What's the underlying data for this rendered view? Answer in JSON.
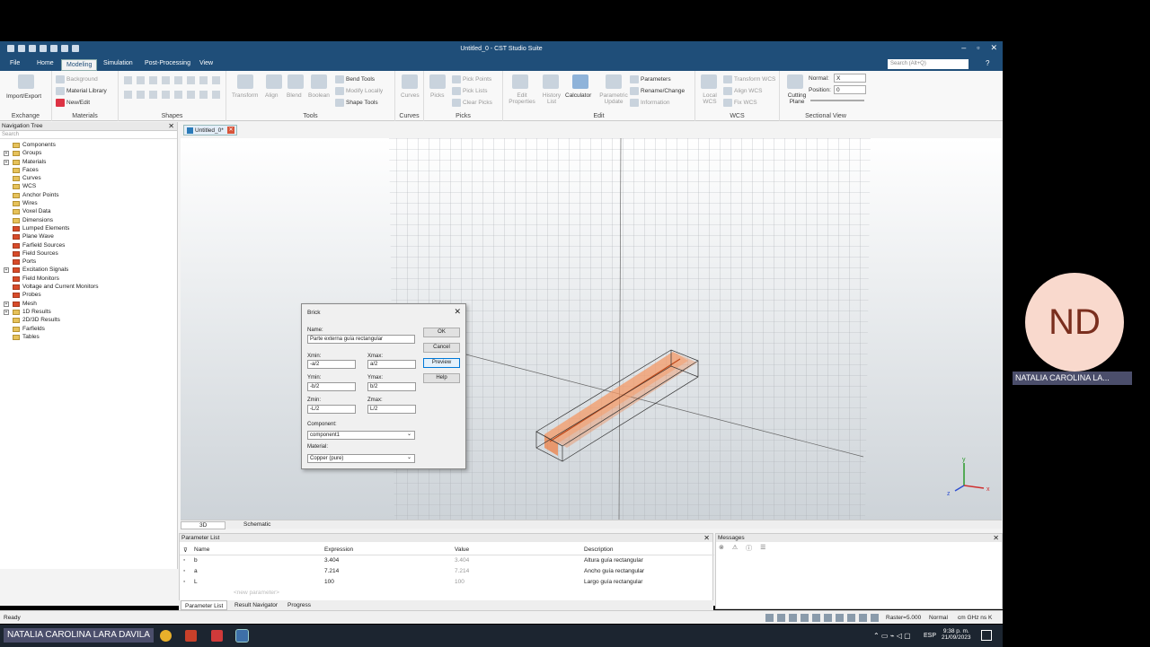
{
  "window": {
    "title": "Untitled_0 - CST Studio Suite",
    "min": "–",
    "max": "▫",
    "close": "✕"
  },
  "menu": {
    "tabs": [
      "File",
      "Home",
      "Modeling",
      "Simulation",
      "Post-Processing",
      "View"
    ],
    "active": "Modeling",
    "search_placeholder": "Search (Alt+Q)"
  },
  "ribbon": {
    "exchange": {
      "label": "Exchange",
      "import_export": "Import/Export"
    },
    "materials": {
      "label": "Materials",
      "background": "Background",
      "material_library": "Material Library",
      "new_edit": "New/Edit"
    },
    "shapes": {
      "label": "Shapes"
    },
    "tools": {
      "label": "Tools",
      "transform": "Transform",
      "align": "Align",
      "blend": "Blend",
      "boolean": "Boolean",
      "bend_tools": "Bend Tools",
      "modify_locally": "Modify Locally",
      "shape_tools": "Shape Tools"
    },
    "curves": {
      "label": "Curves",
      "curves": "Curves"
    },
    "picks": {
      "label": "Picks",
      "picks": "Picks",
      "pick_points": "Pick Points",
      "pick_lists": "Pick Lists",
      "clear_picks": "Clear Picks"
    },
    "edit": {
      "label": "Edit",
      "edit_properties": "Edit Properties",
      "history_list": "History List",
      "calculator": "Calculator",
      "parametric_update": "Parametric Update",
      "parameters": "Parameters",
      "rename_change": "Rename/Change",
      "information": "Information"
    },
    "wcs": {
      "label": "WCS",
      "local_wcs": "Local WCS",
      "transform_wcs": "Transform WCS",
      "align_wcs": "Align WCS",
      "fix_wcs": "Fix WCS"
    },
    "sectional": {
      "label": "Sectional View",
      "cutting_plane": "Cutting Plane",
      "normal_label": "Normal:",
      "normal_value": "X",
      "position_label": "Position:",
      "position_value": "0"
    }
  },
  "nav": {
    "title": "Navigation Tree",
    "search": "Search",
    "items": [
      {
        "label": "Components",
        "red": false,
        "exp": false
      },
      {
        "label": "Groups",
        "red": false,
        "exp": true
      },
      {
        "label": "Materials",
        "red": false,
        "exp": true
      },
      {
        "label": "Faces",
        "red": false,
        "exp": false
      },
      {
        "label": "Curves",
        "red": false,
        "exp": false
      },
      {
        "label": "WCS",
        "red": false,
        "exp": false
      },
      {
        "label": "Anchor Points",
        "red": false,
        "exp": false
      },
      {
        "label": "Wires",
        "red": false,
        "exp": false
      },
      {
        "label": "Voxel Data",
        "red": false,
        "exp": false
      },
      {
        "label": "Dimensions",
        "red": false,
        "exp": false
      },
      {
        "label": "Lumped Elements",
        "red": true,
        "exp": false
      },
      {
        "label": "Plane Wave",
        "red": true,
        "exp": false
      },
      {
        "label": "Farfield Sources",
        "red": true,
        "exp": false
      },
      {
        "label": "Field Sources",
        "red": true,
        "exp": false
      },
      {
        "label": "Ports",
        "red": true,
        "exp": false
      },
      {
        "label": "Excitation Signals",
        "red": true,
        "exp": true
      },
      {
        "label": "Field Monitors",
        "red": true,
        "exp": false
      },
      {
        "label": "Voltage and Current Monitors",
        "red": true,
        "exp": false
      },
      {
        "label": "Probes",
        "red": true,
        "exp": false
      },
      {
        "label": "Mesh",
        "red": true,
        "exp": true
      },
      {
        "label": "1D Results",
        "red": false,
        "exp": true
      },
      {
        "label": "2D/3D Results",
        "red": false,
        "exp": false
      },
      {
        "label": "Farfields",
        "red": false,
        "exp": false
      },
      {
        "label": "Tables",
        "red": false,
        "exp": false
      }
    ]
  },
  "document": {
    "tab": "Untitled_0*"
  },
  "viewtabs": [
    "3D",
    "Schematic"
  ],
  "axes": {
    "x": "x",
    "y": "y",
    "z": "z"
  },
  "dialog": {
    "title": "Brick",
    "name_label": "Name:",
    "name_value": "Parte externa guía rectangular",
    "xmin_label": "Xmin:",
    "xmin": "-a/2",
    "xmax_label": "Xmax:",
    "xmax": "a/2",
    "ymin_label": "Ymin:",
    "ymin": "-b/2",
    "ymax_label": "Ymax:",
    "ymax": "b/2",
    "zmin_label": "Zmin:",
    "zmin": "-L/2",
    "zmax_label": "Zmax:",
    "zmax": "L/2",
    "component_label": "Component:",
    "component": "component1",
    "material_label": "Material:",
    "material": "Copper (pure)",
    "ok": "OK",
    "cancel": "Cancel",
    "preview": "Preview",
    "help": "Help"
  },
  "params": {
    "title": "Parameter List",
    "headers": {
      "name": "Name",
      "expression": "Expression",
      "value": "Value",
      "description": "Description"
    },
    "rows": [
      {
        "name": "b",
        "expression": "3.404",
        "value": "3.404",
        "description": "Altura guía rectangular"
      },
      {
        "name": "a",
        "expression": "7.214",
        "value": "7.214",
        "description": "Ancho guía rectangular"
      },
      {
        "name": "L",
        "expression": "100",
        "value": "100",
        "description": "Largo guía rectangular"
      }
    ],
    "new_placeholder": "<new parameter>",
    "tabs": [
      "Parameter List",
      "Result Navigator",
      "Progress"
    ]
  },
  "messages": {
    "title": "Messages"
  },
  "status": {
    "left": "Ready",
    "raster": "Raster=5.000",
    "mode": "Normal",
    "units": "cm  GHz  ns  K"
  },
  "taskbar": {
    "lang": "ESP",
    "time": "9:38 p. m.",
    "date": "21/09/2023"
  },
  "participant": {
    "initials": "ND",
    "name": "NATALIA CAROLINA LA...",
    "full_name": "NATALIA CAROLINA LARA DAVILA"
  },
  "colors": {
    "brand": "#1f4e79",
    "brick": "#f07a3c",
    "avatar_bg": "#f9d9cd"
  }
}
